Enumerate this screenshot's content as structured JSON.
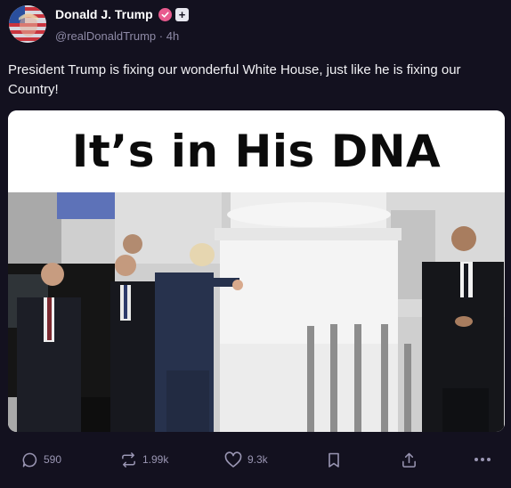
{
  "author": {
    "name": "Donald J. Trump",
    "handle": "@realDonaldTrump",
    "time": "· 4h",
    "avatar_icon": "flag-portrait-avatar",
    "verified_icon": "verified-check-icon",
    "plus_badge": "+"
  },
  "post": {
    "text": "President Trump is fixing our wonderful White House, just like he is fixing our Country!"
  },
  "media": {
    "headline": "It’s in His DNA",
    "photo_icon": "photo-white-house-column"
  },
  "actions": {
    "replies": "590",
    "reposts": "1.99k",
    "likes": "9.3k"
  },
  "colors": {
    "background": "#13111f",
    "muted": "#9a96b3",
    "verified": "#e85a8e"
  }
}
